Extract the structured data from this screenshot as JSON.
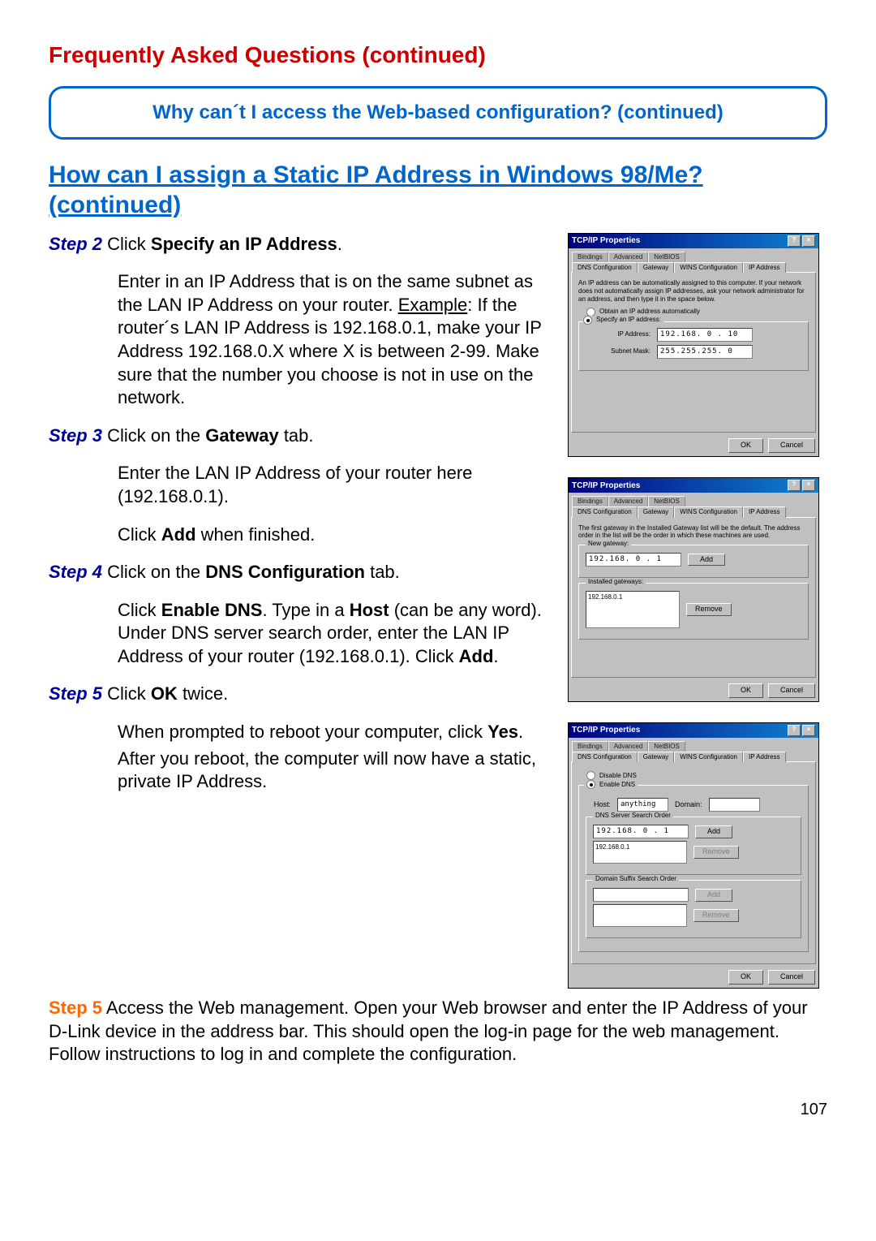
{
  "page_title": "Frequently Asked Questions (continued)",
  "callout": "Why can´t I access the Web-based configuration? (continued)",
  "subheading": "How can I assign a Static IP Address in Windows 98/Me?  (continued)",
  "step2": {
    "label": "Step 2",
    "head_a": " Click ",
    "head_b": "Specify an IP Address",
    "head_c": ".",
    "body_a": "Enter in an IP Address that is on the same subnet as the LAN IP Address on your router. ",
    "body_example": "Example",
    "body_b": ": If the router´s LAN IP Address is 192.168.0.1, make your IP Address 192.168.0.X where X is between 2-99. Make sure that the number you choose is not in use on the network."
  },
  "step3": {
    "label": "Step 3",
    "head_a": " Click on the ",
    "head_b": "Gateway",
    "head_c": " tab.",
    "body1": "Enter the LAN IP Address of your router here (192.168.0.1).",
    "body2_a": "Click ",
    "body2_b": "Add",
    "body2_c": " when finished."
  },
  "step4": {
    "label": "Step 4",
    "head_a": " Click on the ",
    "head_b": "DNS Configuration",
    "head_c": " tab.",
    "body_a": "Click ",
    "body_b": "Enable DNS",
    "body_c": ". Type in a ",
    "body_d": "Host",
    "body_e": " (can be any word). Under DNS server search order, enter the LAN IP Address of your router (192.168.0.1). Click ",
    "body_f": "Add",
    "body_g": "."
  },
  "step5a": {
    "label": "Step 5",
    "head_a": " Click ",
    "head_b": "OK",
    "head_c": " twice.",
    "body1_a": "When prompted to reboot your computer, click ",
    "body1_b": "Yes",
    "body1_c": ".",
    "body2": "After you reboot, the computer will now have a static, private IP Address."
  },
  "step5b": {
    "label": "Step 5",
    "body": "  Access the Web management. Open your Web browser and enter the IP Address of your D-Link device in the address bar. This should open the log-in page for the web management. Follow instructions to log in and complete the configuration."
  },
  "pagenum": "107",
  "dlg": {
    "title": "TCP/IP Properties",
    "help_x": "×",
    "help_q": "?",
    "tabs_back": [
      "Bindings",
      "Advanced",
      "NetBIOS"
    ],
    "tabs_front": [
      "DNS Configuration",
      "Gateway",
      "WINS Configuration",
      "IP Address"
    ],
    "ok": "OK",
    "cancel": "Cancel"
  },
  "dlg1": {
    "help": "An IP address can be automatically assigned to this computer. If your network does not automatically assign IP addresses, ask your network administrator for an address, and then type it in the space below.",
    "opt_auto": "Obtain an IP address automatically",
    "opt_spec": "Specify an IP address:",
    "ip_lbl": "IP Address:",
    "ip_val": "192.168. 0 . 10",
    "mask_lbl": "Subnet Mask:",
    "mask_val": "255.255.255. 0"
  },
  "dlg2": {
    "help": "The first gateway in the Installed Gateway list will be the default. The address order in the list will be the order in which these machines are used.",
    "new_gw": "New gateway:",
    "gw_val": "192.168. 0 . 1",
    "add": "Add",
    "inst_gw": "Installed gateways:",
    "listed": "192.168.0.1",
    "remove": "Remove"
  },
  "dlg3": {
    "disable": "Disable DNS",
    "enable": "Enable DNS",
    "host_lbl": "Host:",
    "host_val": "anything",
    "domain_lbl": "Domain:",
    "search": "DNS Server Search Order",
    "ip_val": "192.168. 0 . 1",
    "add": "Add",
    "listed": "192.168.0.1",
    "remove": "Remove",
    "suffix": "Domain Suffix Search Order",
    "add2": "Add",
    "remove2": "Remove"
  }
}
